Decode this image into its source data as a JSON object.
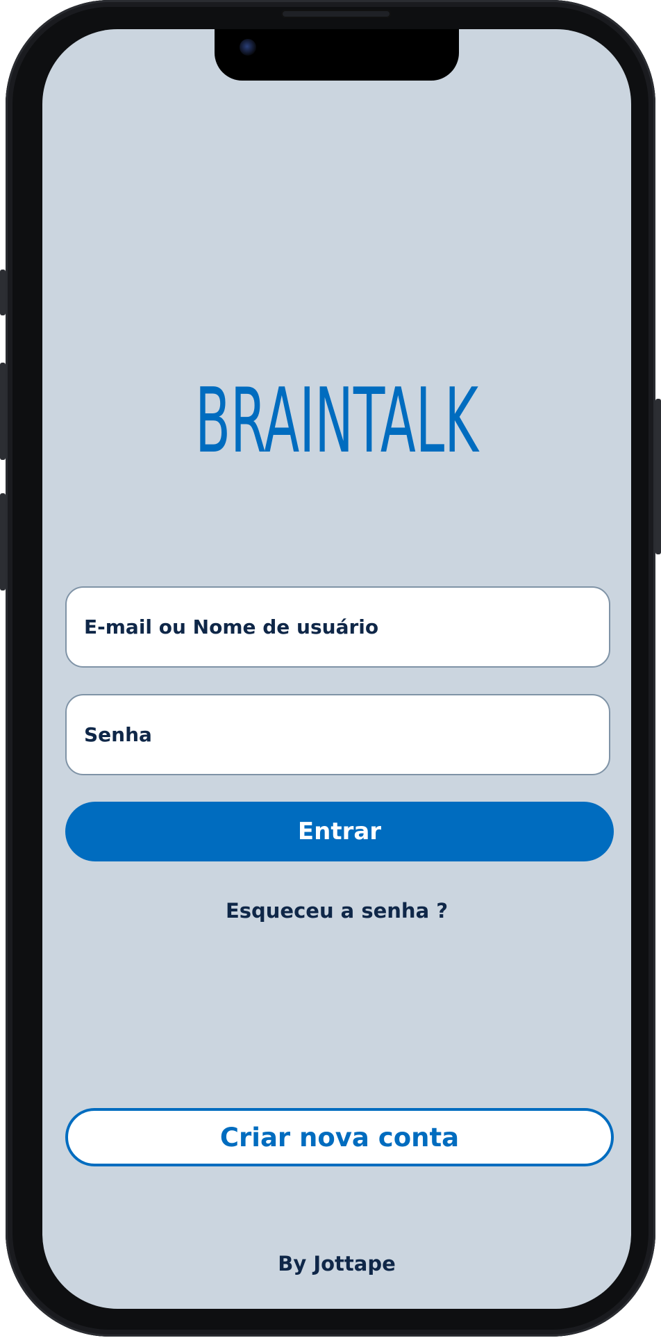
{
  "app": {
    "logo_text": "BRAINTALK"
  },
  "login": {
    "username_placeholder": "E-mail ou Nome de usuário",
    "password_placeholder": "Senha",
    "submit_label": "Entrar",
    "forgot_password": "Esqueceu a senha ?",
    "create_account_label": "Criar nova conta"
  },
  "footer": {
    "credit": "By Jottape"
  },
  "colors": {
    "background": "#cbd5df",
    "primary": "#006cbf",
    "text": "#0f2748",
    "field_border": "#7f93a6"
  }
}
